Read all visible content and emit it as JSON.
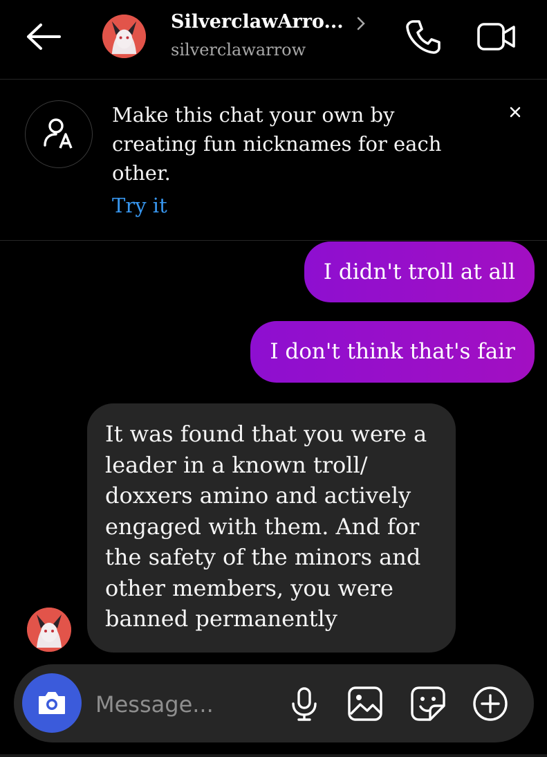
{
  "header": {
    "name": "SilverclawArro...",
    "username": "silverclawarrow",
    "icons": {
      "back": "back-arrow-icon",
      "info": "chevron-right-icon",
      "call": "phone-icon",
      "video": "video-camera-icon"
    }
  },
  "banner": {
    "text": "Make this chat your own by creating fun nicknames for each other.",
    "action_label": "Try it",
    "icon": "nickname-icon",
    "close_icon": "close-icon",
    "link_color": "#3897f0"
  },
  "messages": [
    {
      "direction": "outgoing",
      "text": "I didn't troll at all"
    },
    {
      "direction": "outgoing",
      "text": "I don't think that's fair"
    },
    {
      "direction": "incoming",
      "text": "It was found that you were a leader in a known troll/ doxxers amino and actively engaged with them. And for the safety of the minors and other members, you were banned permanently"
    }
  ],
  "composer": {
    "placeholder": "Message...",
    "icons": [
      "camera-icon",
      "microphone-icon",
      "gallery-icon",
      "sticker-icon",
      "plus-circle-icon"
    ]
  },
  "colors": {
    "background": "#000000",
    "outgoing_bubble": "#9b10c8",
    "incoming_bubble": "#262626",
    "camera_button": "#3b5bdb"
  }
}
